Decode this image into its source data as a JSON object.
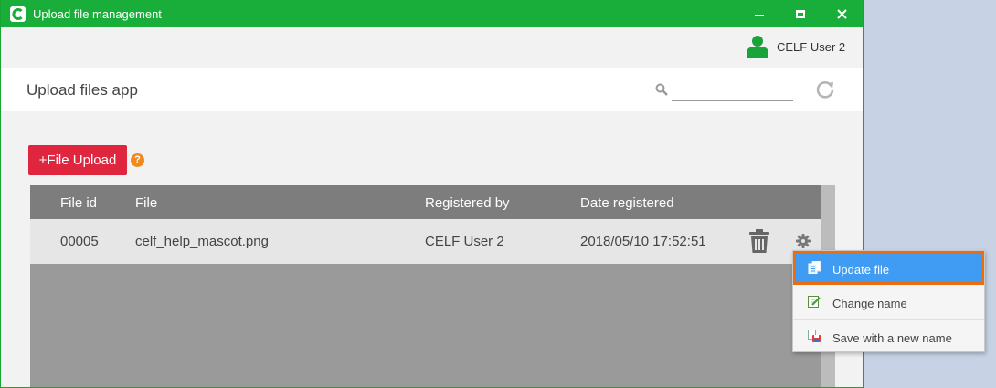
{
  "window": {
    "title": "Upload file management"
  },
  "user": {
    "name": "CELF User 2"
  },
  "app": {
    "title": "Upload files app"
  },
  "search": {
    "placeholder": "",
    "value": ""
  },
  "toolbar": {
    "upload_label": "+File Upload",
    "help_glyph": "?"
  },
  "table": {
    "columns": [
      "File id",
      "File",
      "Registered by",
      "Date registered"
    ],
    "rows": [
      {
        "file_id": "00005",
        "file": "celf_help_mascot.png",
        "registered_by": "CELF User 2",
        "date_registered": "2018/05/10 17:52:51"
      }
    ]
  },
  "context_menu": {
    "items": [
      {
        "label": "Update file",
        "icon": "update-file-icon",
        "selected": true
      },
      {
        "label": "Change name",
        "icon": "edit-icon",
        "selected": false
      },
      {
        "label": "Save with a new name",
        "icon": "save-as-icon",
        "selected": false
      }
    ]
  },
  "colors": {
    "titlebar": "#19ae3a",
    "upload_button": "#e0263e",
    "help_icon": "#f08a1c",
    "menu_highlight": "#3f9cf2",
    "menu_highlight_border": "#ea6d12"
  }
}
